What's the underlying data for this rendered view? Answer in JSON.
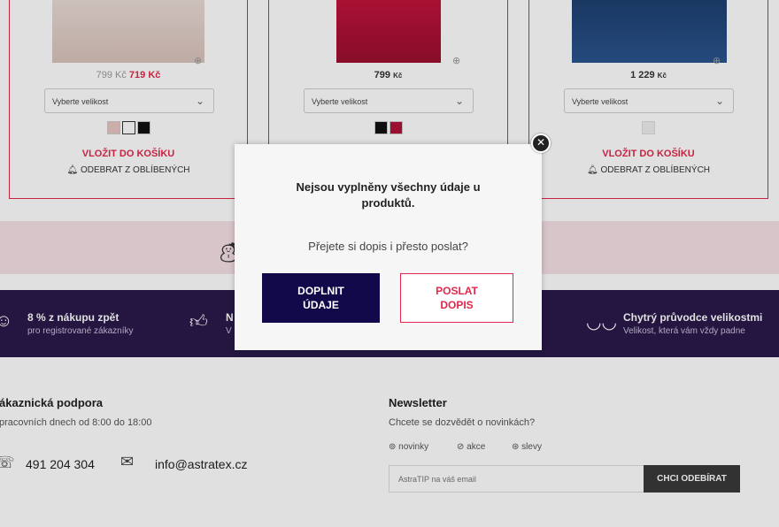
{
  "products": [
    {
      "price_old": "799 Kč",
      "price_new": "719 Kč",
      "size_placeholder": "Vyberte velikost",
      "add_label": "VLOŽIT DO KOŠÍKU",
      "fav_label": "ODEBRAT Z OBLÍBENÝCH",
      "swatches": [
        "#e8c7c2",
        "#ffffff",
        "#111111"
      ]
    },
    {
      "price_amount": "799",
      "price_currency": "Kč",
      "size_placeholder": "Vyberte velikost",
      "swatches": [
        "#111111",
        "#b0123a"
      ]
    },
    {
      "price_amount": "1 229",
      "price_currency": "Kč",
      "size_placeholder": "Vyberte velikost",
      "add_label": "VLOŽIT DO KOŠÍKU",
      "fav_label": "ODEBRAT Z OBLÍBENÝCH",
      "swatches": [
        "#eeeeee"
      ]
    }
  ],
  "benefits": [
    {
      "icon": "piggy-bank-icon",
      "title": "8 % z nákupu zpět",
      "subtitle": "pro registrované zákazníky"
    },
    {
      "icon": "thumbs-up-icon",
      "title": "N",
      "subtitle": "V"
    },
    {
      "icon": "bra-icon",
      "title": "Chytrý průvodce velikostmi",
      "subtitle": "Velikost, která vám vždy padne"
    }
  ],
  "support": {
    "title": "ákaznická podpora",
    "hours": "pracovních dnech od 8:00 do 18:00",
    "phone": "491 204 304",
    "email": "info@astratex.cz"
  },
  "newsletter": {
    "title": "Newsletter",
    "subtitle": "Chcete se dozvědět o novinkách?",
    "tags": [
      "novinky",
      "akce",
      "slevy"
    ],
    "placeholder": "AstraTIP na váš email",
    "button": "CHCI ODEBÍRAT"
  },
  "modal": {
    "title": "Nejsou vyplněny všechny údaje u produktů.",
    "question": "Přejete si dopis i přesto poslat?",
    "primary_button": "DOPLNIT ÚDAJE",
    "secondary_button": "POSLAT DOPIS"
  },
  "colors": {
    "accent": "#e3274c",
    "primary_dark": "#12094a",
    "benefits_bg": "#2a1a4a",
    "pink_strip": "#f6e1e5"
  }
}
